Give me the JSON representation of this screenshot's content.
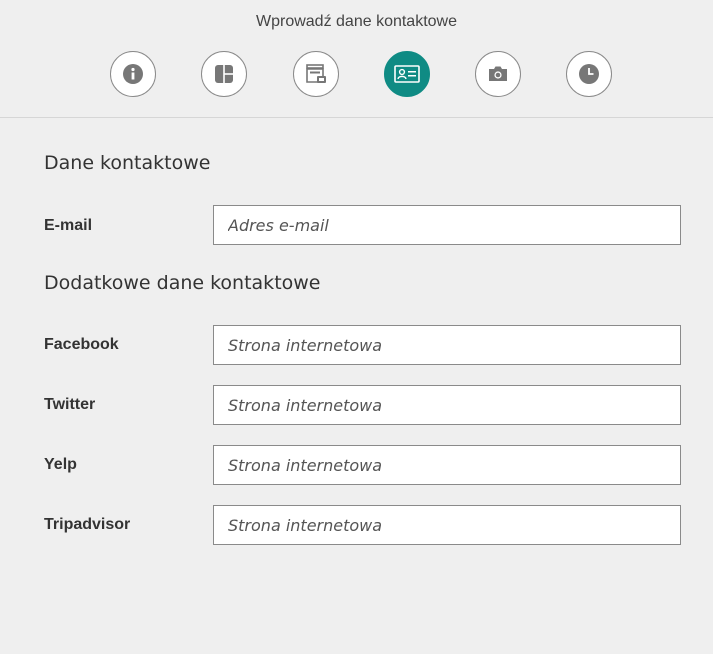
{
  "header": {
    "title": "Wprowadź dane kontaktowe",
    "steps": [
      {
        "icon": "info-icon",
        "active": false
      },
      {
        "icon": "layout-icon",
        "active": false
      },
      {
        "icon": "store-icon",
        "active": false
      },
      {
        "icon": "contact-card-icon",
        "active": true
      },
      {
        "icon": "camera-icon",
        "active": false
      },
      {
        "icon": "clock-icon",
        "active": false
      }
    ],
    "active_color": "#0f8b84"
  },
  "contact": {
    "title": "Dane kontaktowe",
    "email": {
      "label": "E-mail",
      "placeholder": "Adres e-mail",
      "value": ""
    }
  },
  "additional": {
    "title": "Dodatkowe dane kontaktowe",
    "fields": [
      {
        "label": "Facebook",
        "placeholder": "Strona internetowa",
        "value": ""
      },
      {
        "label": "Twitter",
        "placeholder": "Strona internetowa",
        "value": ""
      },
      {
        "label": "Yelp",
        "placeholder": "Strona internetowa",
        "value": ""
      },
      {
        "label": "Tripadvisor",
        "placeholder": "Strona internetowa",
        "value": ""
      }
    ]
  }
}
